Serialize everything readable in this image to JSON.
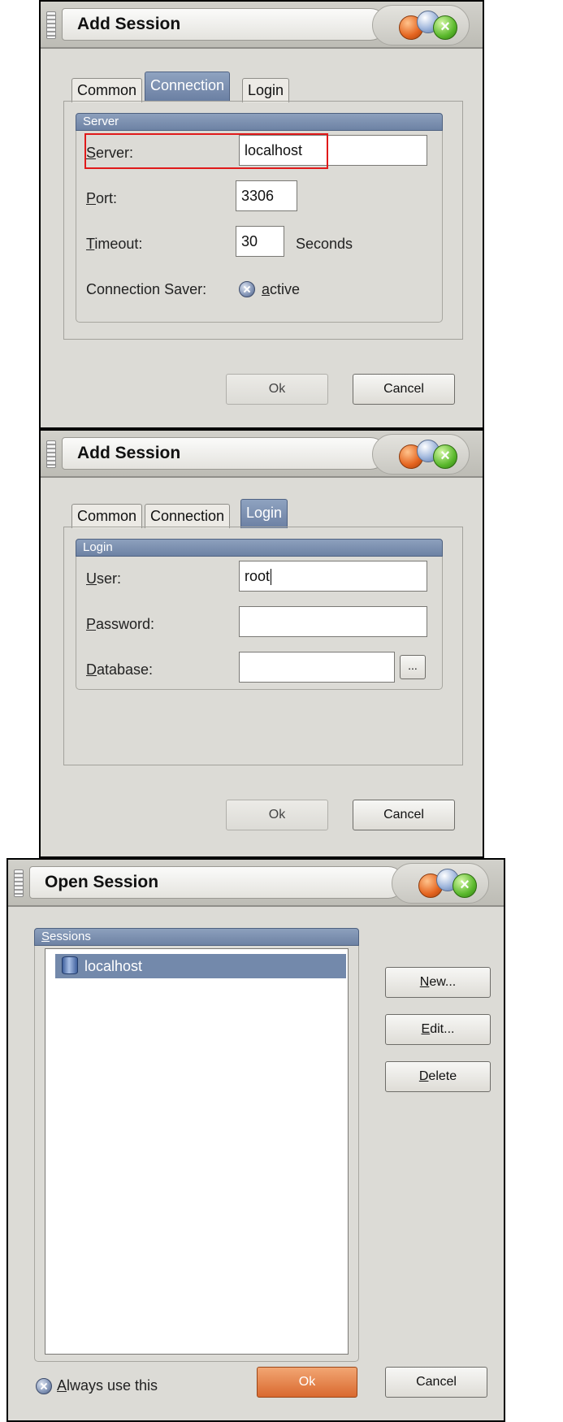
{
  "dialog1": {
    "title": "Add Session",
    "tabs": [
      "Common",
      "Connection",
      "Login"
    ],
    "active_tab": "Connection",
    "group_title": "Server",
    "server_label_u": "S",
    "server_label_rest": "erver:",
    "server_value": "localhost",
    "port_label_u": "P",
    "port_label_rest": "ort:",
    "port_value": "3306",
    "timeout_label_u": "T",
    "timeout_label_rest": "imeout:",
    "timeout_value": "30",
    "timeout_unit": "Seconds",
    "saver_label": "Connection Saver:",
    "saver_option_u": "a",
    "saver_option_rest": "ctive",
    "ok_label": "Ok",
    "cancel_label": "Cancel"
  },
  "dialog2": {
    "title": "Add Session",
    "tabs": [
      "Common",
      "Connection",
      "Login"
    ],
    "active_tab": "Login",
    "group_title": "Login",
    "user_label_u": "U",
    "user_label_rest": "ser:",
    "user_value": "root",
    "password_label_u": "P",
    "password_label_rest": "assword:",
    "password_value": "",
    "database_label_u": "D",
    "database_label_rest": "atabase:",
    "database_value": "",
    "browse_label": "...",
    "ok_label": "Ok",
    "cancel_label": "Cancel"
  },
  "dialog3": {
    "title": "Open Session",
    "group_title_u": "S",
    "group_title_rest": "essions",
    "sessions": [
      {
        "name": "localhost",
        "icon": "database-icon",
        "selected": true
      }
    ],
    "new_u": "N",
    "new_rest": "ew...",
    "edit_u": "E",
    "edit_rest": "dit...",
    "delete_u": "D",
    "delete_rest": "elete",
    "always_u": "A",
    "always_rest": "lways use this",
    "ok_label": "Ok",
    "cancel_label": "Cancel"
  },
  "colors": {
    "dialog_bg": "#dcdbd6",
    "tab_active": "#7389ab",
    "selection": "#7389ab",
    "ok_orange": "#d9692f",
    "highlight_red": "#e01a1a"
  }
}
